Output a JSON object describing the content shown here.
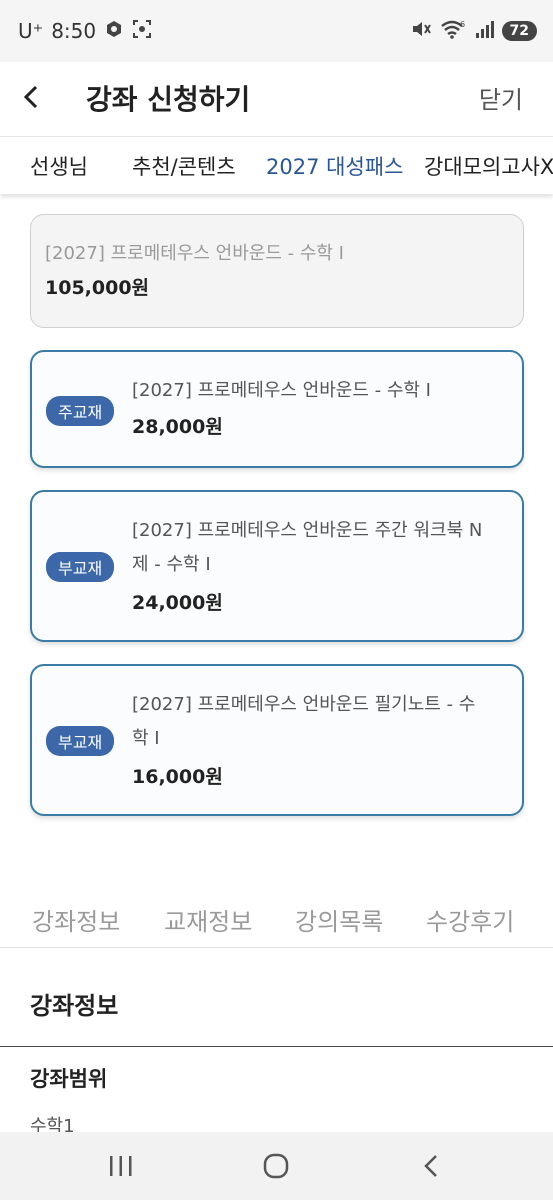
{
  "status": {
    "carrier": "U⁺",
    "time": "8:50",
    "battery": "72",
    "wifi_label": "6"
  },
  "header": {
    "title": "강좌 신청하기",
    "close_label": "닫기"
  },
  "tabs": [
    {
      "label": "선생님",
      "active": false
    },
    {
      "label": "추천/콘텐츠",
      "active": false
    },
    {
      "label": "2027 대성패스",
      "active": true
    },
    {
      "label": "강대모의고사X",
      "active": false
    }
  ],
  "lecture": {
    "title": "[2027] 프로메테우스 언바운드 - 수학 Ⅰ",
    "price": "105,000원"
  },
  "books": [
    {
      "badge": "주교재",
      "title_lines": [
        "[2027] 프로메테우스 언바운드 - 수학 Ⅰ"
      ],
      "price": "28,000원"
    },
    {
      "badge": "부교재",
      "title_lines": [
        "[2027] 프로메테우스 언바운드 주간 워크북 N",
        "제 - 수학 Ⅰ"
      ],
      "price": "24,000원"
    },
    {
      "badge": "부교재",
      "title_lines": [
        "[2027] 프로메테우스 언바운드 필기노트 - 수",
        "학 Ⅰ"
      ],
      "price": "16,000원"
    }
  ],
  "bottom_tabs": [
    "강좌정보",
    "교재정보",
    "강의목록",
    "수강후기"
  ],
  "section": {
    "title": "강좌정보",
    "sub_title": "강좌범위",
    "sub_value": "수학1"
  },
  "colors": {
    "accent": "#3c67a8",
    "card_border": "#3a7ca5",
    "tab_active": "#2a5596"
  }
}
